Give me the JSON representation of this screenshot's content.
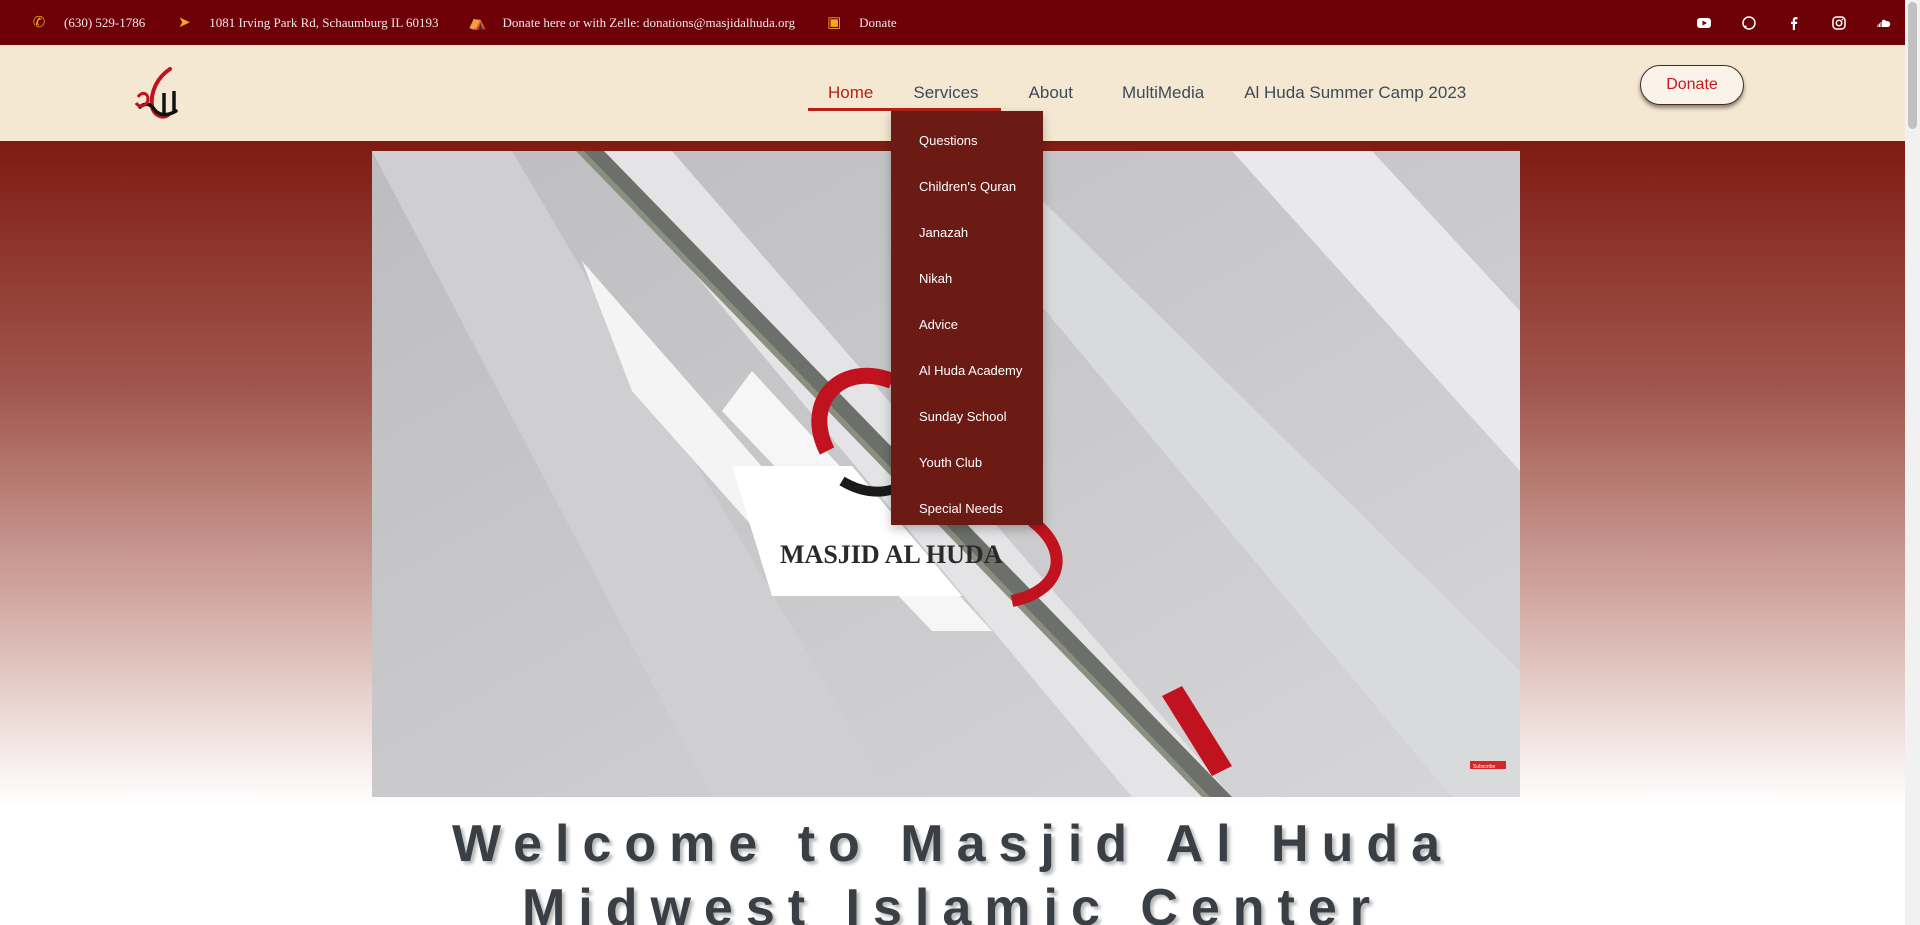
{
  "topbar": {
    "phone": "(630) 529-1786",
    "address": "1081 Irving Park Rd, Schaumburg IL 60193",
    "zelle": "Donate here or with Zelle: donations@masjidalhuda.org",
    "donate": "Donate",
    "social": [
      "youtube-icon",
      "whatsapp-icon",
      "facebook-icon",
      "instagram-icon",
      "soundcloud-icon"
    ]
  },
  "nav": {
    "items": [
      "Home",
      "Services",
      "About",
      "MultiMedia",
      "Al Huda Summer Camp 2023"
    ],
    "active": "Home",
    "donate_label": "Donate"
  },
  "services_menu": [
    "Questions",
    "Children's Quran",
    "Janazah",
    "Nikah",
    "Advice",
    "Al Huda Academy",
    "Sunday School",
    "Youth Club",
    "Special Needs"
  ],
  "video": {
    "caption": "MASJID AL HUDA",
    "badge": "Subscribe"
  },
  "welcome": {
    "line1": "Welcome to Masjid Al Huda",
    "line2": "Midwest Islamic Center"
  },
  "colors": {
    "topbar": "#6e0008",
    "header": "#f5e8d3",
    "accent": "#b52116",
    "dropdown": "#6b1b14",
    "icon": "#f0a91c"
  }
}
